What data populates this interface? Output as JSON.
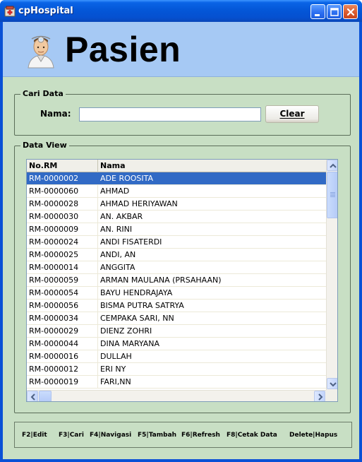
{
  "window": {
    "title": "cpHospital"
  },
  "header": {
    "title": "Pasien"
  },
  "search": {
    "legend": "Cari Data",
    "name_label": "Nama:",
    "name_value": "",
    "clear_label": "Clear"
  },
  "dataview": {
    "legend": "Data View",
    "columns": [
      "No.RM",
      "Nama"
    ],
    "selected_index": 0,
    "rows": [
      {
        "rm": "RM-0000002",
        "nama": "ADE ROOSITA"
      },
      {
        "rm": "RM-0000060",
        "nama": "AHMAD"
      },
      {
        "rm": "RM-0000028",
        "nama": "AHMAD HERIYAWAN"
      },
      {
        "rm": "RM-0000030",
        "nama": "AN. AKBAR"
      },
      {
        "rm": "RM-0000009",
        "nama": "AN. RINI"
      },
      {
        "rm": "RM-0000024",
        "nama": "ANDI FISATERDI"
      },
      {
        "rm": "RM-0000025",
        "nama": "ANDI, AN"
      },
      {
        "rm": "RM-0000014",
        "nama": "ANGGITA"
      },
      {
        "rm": "RM-0000059",
        "nama": "ARMAN MAULANA (PRSAHAAN)"
      },
      {
        "rm": "RM-0000054",
        "nama": "BAYU HENDRAJAYA"
      },
      {
        "rm": "RM-0000056",
        "nama": "BISMA PUTRA SATRYA"
      },
      {
        "rm": "RM-0000034",
        "nama": "CEMPAKA SARI, NN"
      },
      {
        "rm": "RM-0000029",
        "nama": "DIENZ ZOHRI"
      },
      {
        "rm": "RM-0000044",
        "nama": "DINA MARYANA"
      },
      {
        "rm": "RM-0000016",
        "nama": "DULLAH"
      },
      {
        "rm": "RM-0000012",
        "nama": "ERI NY"
      },
      {
        "rm": "RM-0000019",
        "nama": "FARI,NN"
      }
    ]
  },
  "shortcuts": {
    "edit": "F2|Edit",
    "cari": "F3|Cari",
    "navigasi": "F4|Navigasi",
    "tambah": "F5|Tambah",
    "refresh": "F6|Refresh",
    "cetak": "F8|Cetak Data",
    "hapus": "Delete|Hapus"
  },
  "icons": {
    "app": "hospital-app-icon",
    "header": "doctor-icon",
    "minimize": "minimize-icon",
    "maximize": "maximize-icon",
    "close": "close-icon"
  },
  "colors": {
    "titlebar": "#0457d8",
    "header_band": "#a6c9f4",
    "client_bg": "#c8dfc4",
    "selection": "#316ac5"
  }
}
